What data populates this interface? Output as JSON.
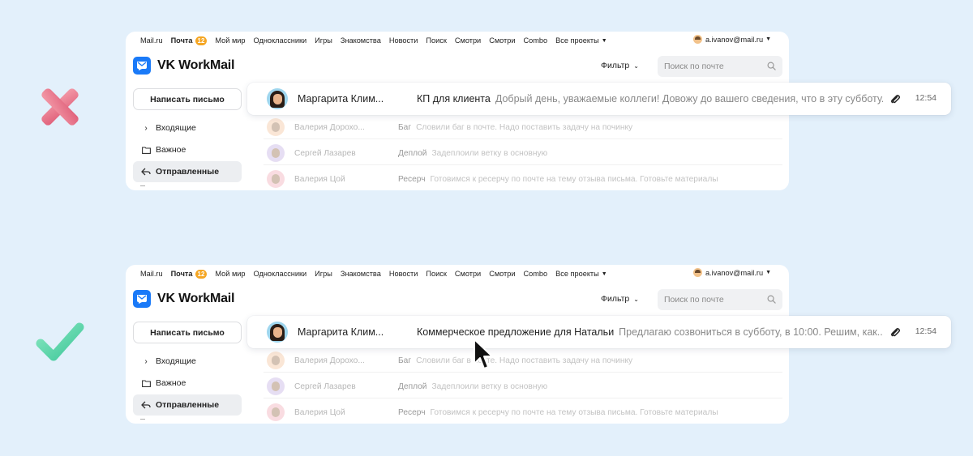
{
  "topnav": {
    "items": [
      "Mail.ru",
      "Почта",
      "Мой мир",
      "Одноклассники",
      "Игры",
      "Знакомства",
      "Новости",
      "Поиск",
      "Смотри",
      "Смотри",
      "Combo",
      "Все проекты"
    ],
    "mail_badge": "12",
    "user_email": "a.ivanov@mail.ru"
  },
  "header": {
    "app_name": "VK WorkMail",
    "filter_label": "Фильтр",
    "search_placeholder": "Поиск по почте"
  },
  "sidebar": {
    "compose_label": "Написать письмо",
    "folders": [
      "Входящие",
      "Важное",
      "Отправленные"
    ],
    "active_folder": "Отправленные"
  },
  "faded_rows": [
    {
      "sender": "Валерия Дорохо...",
      "subject": "Баг",
      "preview": "Словили баг в почте. Надо поставить задачу на починку",
      "avatar_color": "#f6c9a6"
    },
    {
      "sender": "Сергей Лазарев",
      "subject": "Деплой",
      "preview": "Задеплоили ветку в основную",
      "avatar_color": "#c9b7e6"
    },
    {
      "sender": "Валерия Цой",
      "subject": "Ресерч",
      "preview": "Готовимся к ресерчу по почте на тему отзыва письма. Готовьте материалы",
      "avatar_color": "#f3b3be"
    }
  ],
  "bad_example": {
    "sender": "Маргарита Клим...",
    "subject": "КП для клиента",
    "preview": "Добрый день, уважаемые коллеги! Довожу до вашего сведения, что в эту субботу...",
    "time": "12:54"
  },
  "good_example": {
    "sender": "Маргарита Клим...",
    "subject": "Коммерческое предложение для Натальи",
    "preview": "Предлагаю созвониться в субботу, в 10:00. Решим, как...",
    "time": "12:54"
  },
  "colors": {
    "background": "#e3f0fb",
    "brand": "#1a7af8",
    "badge": "#f5a623",
    "bad_mark": "#e8778c",
    "good_mark": "#5fd3a6"
  },
  "icons": {
    "bad": "cross-mark-icon",
    "good": "check-mark-icon",
    "cursor": "mouse-pointer-icon",
    "attachment": "paperclip-icon",
    "search": "search-icon"
  }
}
